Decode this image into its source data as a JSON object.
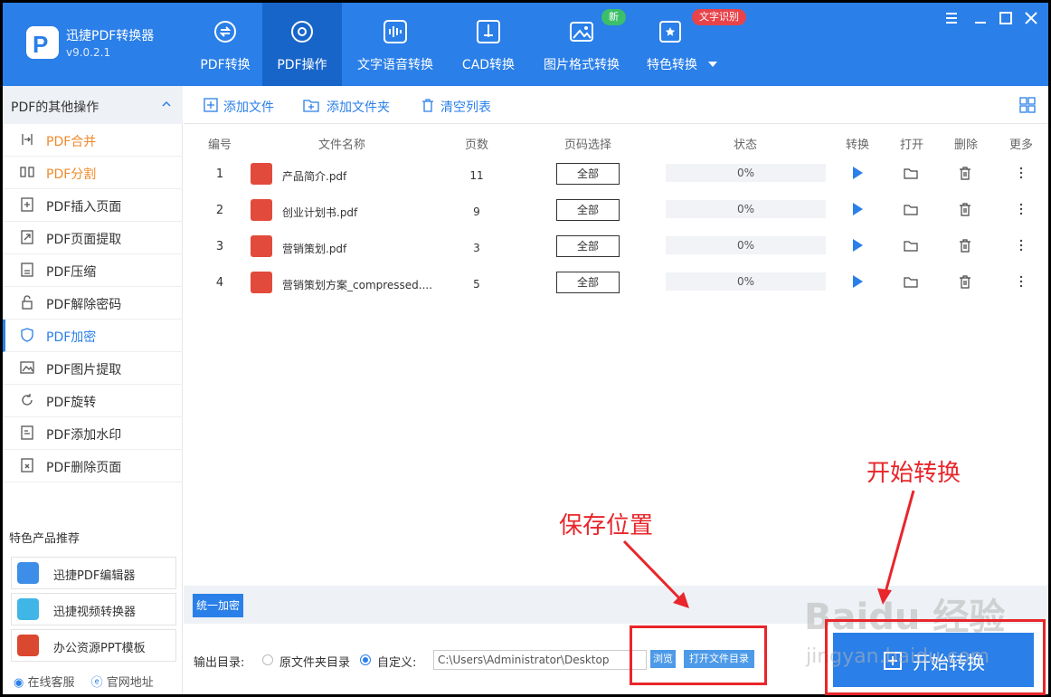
{
  "app": {
    "name": "迅捷PDF转换器",
    "version": "v9.0.2.1"
  },
  "nav": [
    {
      "label": "PDF转换",
      "icon": "pdf-convert-icon"
    },
    {
      "label": "PDF操作",
      "icon": "gear-icon",
      "active": true
    },
    {
      "label": "文字语音转换",
      "icon": "audio-wave-icon"
    },
    {
      "label": "CAD转换",
      "icon": "cad-icon"
    },
    {
      "label": "图片格式转换",
      "icon": "image-icon"
    },
    {
      "label": "特色转换",
      "icon": "star-convert-icon"
    }
  ],
  "badges": {
    "new": "新",
    "ocr": "文字识别"
  },
  "sidebar": {
    "title": "PDF的其他操作",
    "items": [
      {
        "label": "PDF合并"
      },
      {
        "label": "PDF分割"
      },
      {
        "label": "PDF插入页面"
      },
      {
        "label": "PDF页面提取"
      },
      {
        "label": "PDF压缩"
      },
      {
        "label": "PDF解除密码"
      },
      {
        "label": "PDF加密",
        "selected": true
      },
      {
        "label": "PDF图片提取"
      },
      {
        "label": "PDF旋转"
      },
      {
        "label": "PDF添加水印"
      },
      {
        "label": "PDF删除页面"
      }
    ],
    "promo_title": "特色产品推荐",
    "promos": [
      {
        "label": "迅捷PDF编辑器"
      },
      {
        "label": "迅捷视频转换器"
      },
      {
        "label": "办公资源PPT模板"
      }
    ],
    "footer": {
      "service": "在线客服",
      "website": "官网地址"
    }
  },
  "toolbar": {
    "add_file": "添加文件",
    "add_folder": "添加文件夹",
    "clear_list": "清空列表"
  },
  "table": {
    "headers": [
      "编号",
      "文件名称",
      "页数",
      "页码选择",
      "状态",
      "转换",
      "打开",
      "删除",
      "更多"
    ],
    "rows": [
      {
        "no": "1",
        "name": "产品简介.pdf",
        "pages": "11",
        "range": "全部",
        "status": "0%"
      },
      {
        "no": "2",
        "name": "创业计划书.pdf",
        "pages": "9",
        "range": "全部",
        "status": "0%"
      },
      {
        "no": "3",
        "name": "营销策划.pdf",
        "pages": "3",
        "range": "全部",
        "status": "0%"
      },
      {
        "no": "4",
        "name": "营销策划方案_compressed....",
        "pages": "5",
        "range": "全部",
        "status": "0%"
      }
    ]
  },
  "bottom": {
    "unified_encrypt": "统一加密",
    "output_label": "输出目录:",
    "option_original": "原文件夹目录",
    "option_custom": "自定义:",
    "path": "C:\\Users\\Administrator\\Desktop",
    "browse": "浏览",
    "open_dir": "打开文件目录",
    "start": "开始转换"
  },
  "annotations": {
    "save_location": "保存位置",
    "start_convert": "开始转换"
  },
  "watermark": {
    "line1": "Baidu 经验",
    "line2": "jingyan.baidu.com"
  },
  "colors": {
    "brand": "#2a7fe8",
    "annotation": "#e8262b",
    "orange": "#f08a2b",
    "pdf_red": "#e24a3b"
  }
}
